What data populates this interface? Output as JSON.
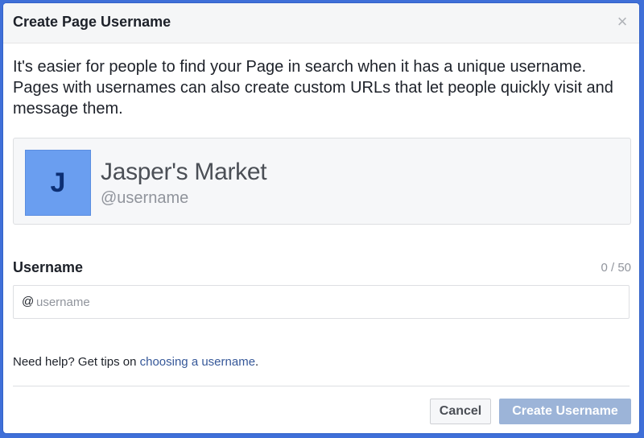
{
  "dialog": {
    "title": "Create Page Username",
    "close_icon": "close-icon",
    "description": "It's easier for people to find your Page in search when it has a unique username. Pages with usernames can also create custom URLs that let people quickly visit and message them."
  },
  "preview": {
    "avatar_letter": "J",
    "page_name": "Jasper's Market",
    "handle": "@username"
  },
  "username_field": {
    "label": "Username",
    "count": "0 / 50",
    "prefix": "@",
    "placeholder": "username",
    "value": ""
  },
  "help": {
    "text": "Need help? Get tips on ",
    "link": "choosing a username",
    "suffix": "."
  },
  "footer": {
    "cancel_label": "Cancel",
    "create_label": "Create Username"
  },
  "colors": {
    "backdrop": "#3f6fd8",
    "avatar": "#6a9ef0",
    "link": "#365899",
    "primary_disabled": "#9cb4d8"
  }
}
